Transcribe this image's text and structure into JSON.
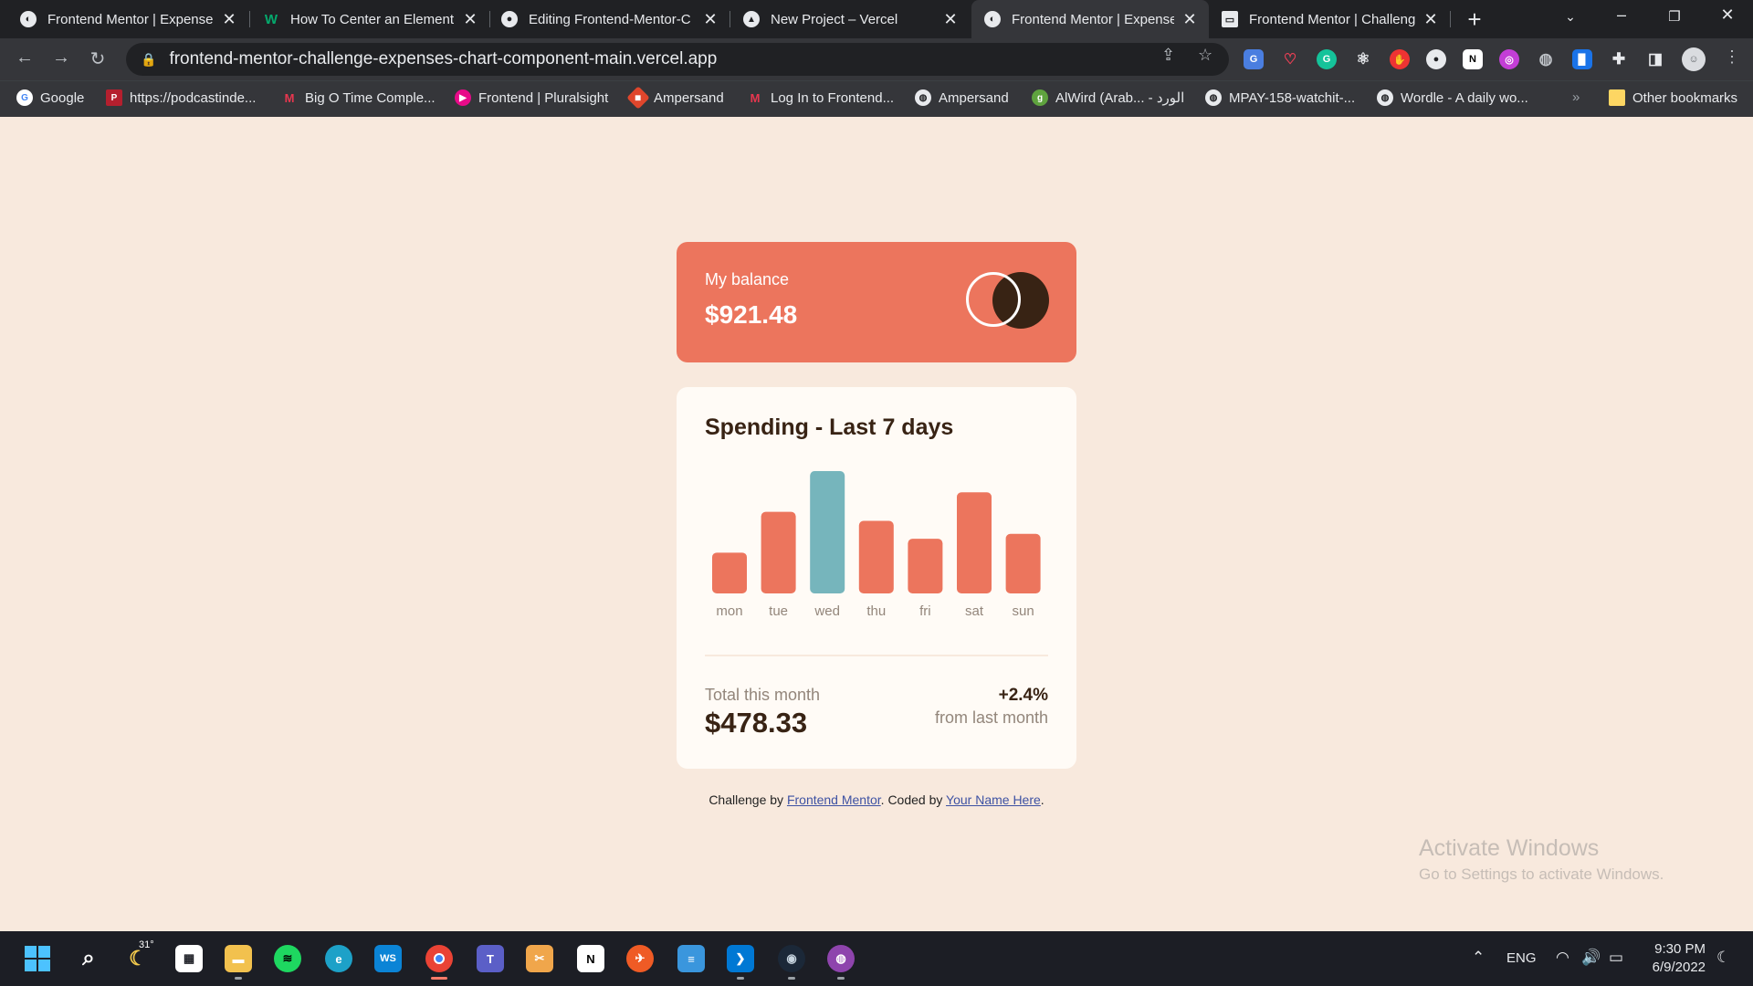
{
  "browser": {
    "tabs": [
      {
        "title": "Frontend Mentor | Expense",
        "favicon": "globe-icon",
        "active": false
      },
      {
        "title": "How To Center an Element",
        "favicon": "w3schools-icon",
        "active": false
      },
      {
        "title": "Editing Frontend-Mentor-C",
        "favicon": "github-icon",
        "active": false
      },
      {
        "title": "New Project – Vercel",
        "favicon": "vercel-icon",
        "active": false
      },
      {
        "title": "Frontend Mentor | Expense",
        "favicon": "globe-icon",
        "active": true
      },
      {
        "title": "Frontend Mentor | Challeng",
        "favicon": "page-icon",
        "active": false
      }
    ],
    "url": "frontend-mentor-challenge-expenses-chart-component-main.vercel.app",
    "bookmarks": [
      {
        "label": "Google",
        "icon": "google-icon"
      },
      {
        "label": "https://podcastinde...",
        "icon": "podcast-icon"
      },
      {
        "label": "Big O Time Comple...",
        "icon": "medium-icon"
      },
      {
        "label": "Frontend | Pluralsight",
        "icon": "pluralsight-icon"
      },
      {
        "label": "Ampersand",
        "icon": "ampersand-icon"
      },
      {
        "label": "Log In to Frontend...",
        "icon": "medium-icon"
      },
      {
        "label": "Ampersand",
        "icon": "globe-icon"
      },
      {
        "label": "AlWird (Arab... - الورد",
        "icon": "alwird-icon"
      },
      {
        "label": "MPAY-158-watchit-...",
        "icon": "globe-icon"
      },
      {
        "label": "Wordle - A daily wo...",
        "icon": "globe-icon"
      }
    ],
    "other_bookmarks": "Other bookmarks"
  },
  "balance": {
    "label": "My balance",
    "amount": "$921.48"
  },
  "spending": {
    "title": "Spending - Last 7 days",
    "total_label": "Total this month",
    "total_amount": "$478.33",
    "change_pct": "+2.4%",
    "change_sub": "from last month"
  },
  "chart_data": {
    "type": "bar",
    "categories": [
      "mon",
      "tue",
      "wed",
      "thu",
      "fri",
      "sat",
      "sun"
    ],
    "values": [
      17.45,
      34.91,
      52.36,
      31.07,
      23.39,
      43.28,
      25.48
    ],
    "highlight_index": 2,
    "colors": {
      "bar": "#ec755d",
      "highlight": "#76b5bc",
      "label": "#93867b"
    },
    "title": "",
    "xlabel": "",
    "ylabel": "",
    "grid": false
  },
  "attribution": {
    "prefix": "Challenge by ",
    "link1": "Frontend Mentor",
    "middle": ". Coded by ",
    "link2": "Your Name Here",
    "suffix": "."
  },
  "watermark": {
    "title": "Activate Windows",
    "subtitle": "Go to Settings to activate Windows."
  },
  "taskbar": {
    "weather": "31°",
    "language": "ENG",
    "time": "9:30 PM",
    "date": "6/9/2022"
  }
}
